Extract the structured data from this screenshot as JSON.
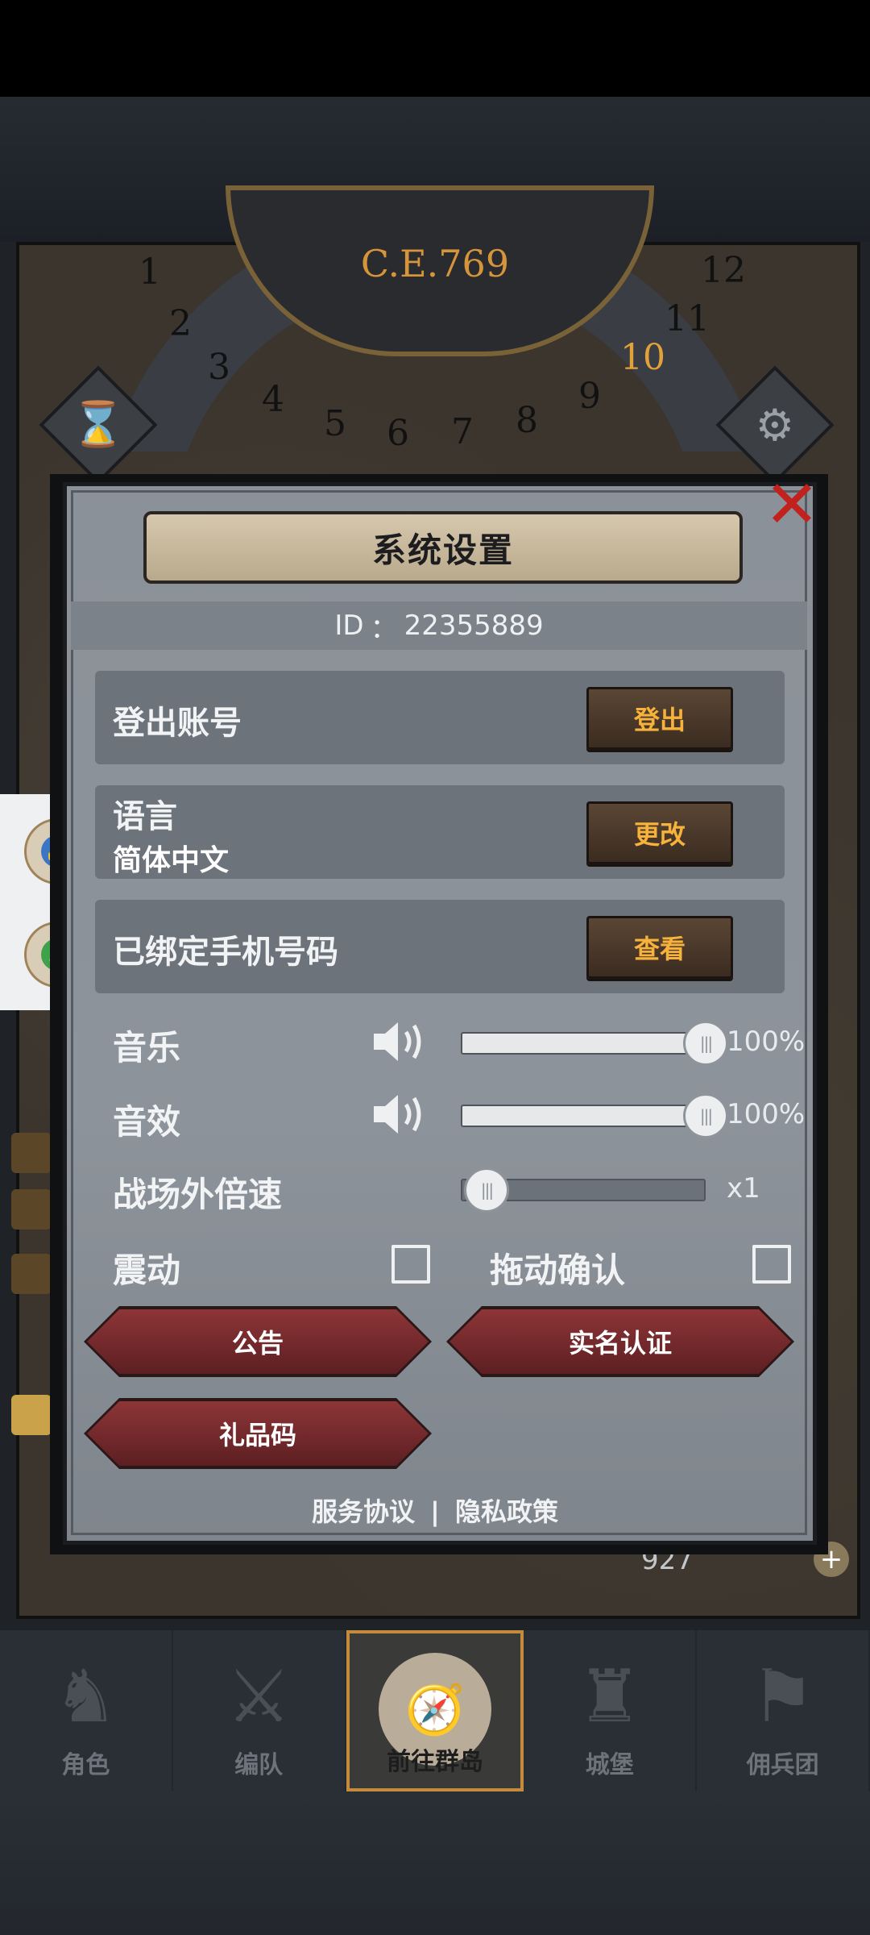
{
  "game": {
    "year": "C.E.769",
    "ring_numbers": [
      "1",
      "2",
      "3",
      "4",
      "5",
      "6",
      "7",
      "8",
      "9",
      "10",
      "11",
      "12"
    ],
    "active_ring_number": "10",
    "coins": "927"
  },
  "dialog": {
    "title": "系统设置",
    "id_label": "ID",
    "id_sep": "：",
    "id_value": "22355889",
    "rows": {
      "logout": {
        "label": "登出账号",
        "button": "登出"
      },
      "language": {
        "label": "语言",
        "value": "简体中文",
        "button": "更改"
      },
      "phone": {
        "label": "已绑定手机号码",
        "button": "查看"
      }
    },
    "settings": {
      "music": {
        "label": "音乐",
        "value": "100%",
        "level": 1.0
      },
      "sfx": {
        "label": "音效",
        "value": "100%",
        "level": 1.0
      },
      "speed": {
        "label": "战场外倍速",
        "value": "x1",
        "level": 0.0
      },
      "vibration": {
        "label": "震动",
        "checked": false
      },
      "drag_confirm": {
        "label": "拖动确认",
        "checked": false
      }
    },
    "buttons": {
      "notice": "公告",
      "realname": "实名认证",
      "gift": "礼品码"
    },
    "footer": {
      "service": "服务协议",
      "separator": "|",
      "privacy": "隐私政策"
    }
  },
  "nav": {
    "tabs": [
      {
        "label": "角色",
        "icon": "knight-icon",
        "active": false
      },
      {
        "label": "编队",
        "icon": "formation-icon",
        "active": false
      },
      {
        "label": "前往群岛",
        "icon": "islands-globe-icon",
        "active": true
      },
      {
        "label": "城堡",
        "icon": "castle-icon",
        "active": false
      },
      {
        "label": "佣兵团",
        "icon": "mercenary-icon",
        "active": false
      }
    ]
  },
  "colors": {
    "accent_gold": "#f7b23b",
    "close_red": "#c1221d",
    "red_button": "#8d3537",
    "active_tab_border": "#c38b3a"
  }
}
